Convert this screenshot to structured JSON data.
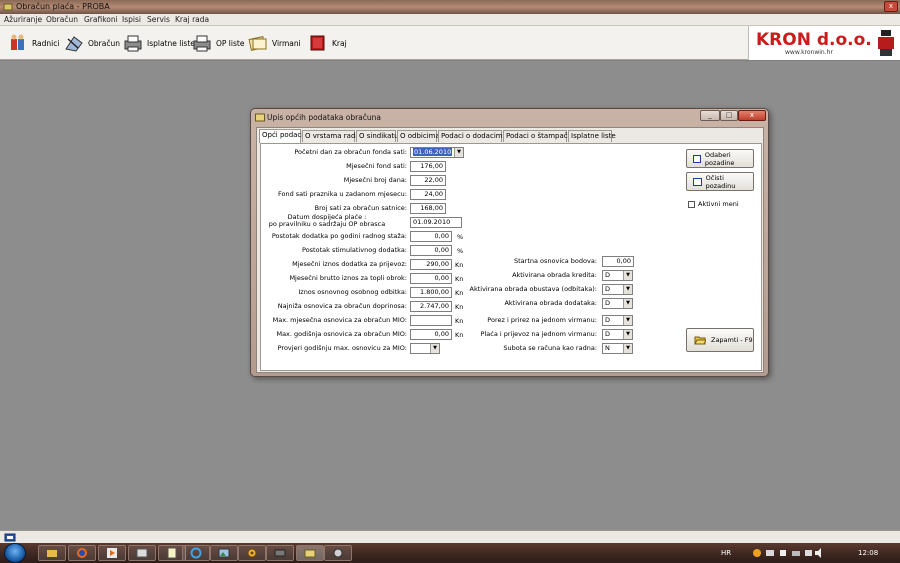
{
  "app": {
    "title": "Obračun plaća - PROBA",
    "close_glyph": "x"
  },
  "menu": [
    "Ažuriranje",
    "Obračun",
    "Grafikoni",
    "Ispisi",
    "Servis",
    "Kraj rada"
  ],
  "toolbar": {
    "buttons": [
      {
        "label": "Radnici",
        "icon": "workers-icon"
      },
      {
        "label": "Obračun",
        "icon": "calculation-icon"
      },
      {
        "label": "Isplatne liste",
        "icon": "payslips-printer-icon"
      },
      {
        "label": "OP liste",
        "icon": "op-lists-printer-icon"
      },
      {
        "label": "Virmani",
        "icon": "transfer-orders-icon"
      },
      {
        "label": "Kraj",
        "icon": "exit-icon"
      }
    ],
    "logo": {
      "name": "KRON d.o.o.",
      "url": "www.kronwin.hr"
    }
  },
  "dialog": {
    "title": "Upis općih podataka obračuna",
    "window_buttons": {
      "minimize": "_",
      "maximize": "□",
      "close": "x"
    },
    "tabs": [
      "Opći podaci",
      "O vrstama rada",
      "O sindikatu",
      "O odbicima",
      "Podaci o dodacima",
      "Podaci o štampaču",
      "Isplatne liste"
    ],
    "active_tab": "Opći podaci",
    "left_fields": [
      {
        "label": "Početni dan za obračun fonda sati:",
        "value": "01.06.2010",
        "unit": "",
        "dropdown": true
      },
      {
        "label": "Mjesečni fond sati:",
        "value": "176,00",
        "unit": ""
      },
      {
        "label": "Mjesečni broj dana:",
        "value": "22,00",
        "unit": ""
      },
      {
        "label": "Fond sati praznika u zadanom mjesecu:",
        "value": "24,00",
        "unit": ""
      },
      {
        "label": "Broj sati za obračun satnice:",
        "value": "168,00",
        "unit": ""
      },
      {
        "label": "Datum dospijeća plaće :\npo pravilniku o sadržaju OP obrasca",
        "value": "01.09.2010",
        "unit": ""
      },
      {
        "label": "Postotak dodatka po godini radnog staža:",
        "value": "0,00",
        "unit": "%"
      },
      {
        "label": "Postotak stimulativnog dodatka:",
        "value": "0,00",
        "unit": "%"
      },
      {
        "label": "Mjesečni iznos dodatka za prijevoz:",
        "value": "290,00",
        "unit": "Kn"
      },
      {
        "label": "Mjesečni brutto iznos za topli obrok:",
        "value": "0,00",
        "unit": "Kn"
      },
      {
        "label": "Iznos osnovnog osobnog odbitka:",
        "value": "1.800,00",
        "unit": "Kn"
      },
      {
        "label": "Najniža osnovica za obračun doprinosa:",
        "value": "2.747,00",
        "unit": "Kn"
      },
      {
        "label": "Max. mjesečna osnovica za obračun MIO:",
        "value": "",
        "unit": "Kn"
      },
      {
        "label": "Max. godišnja osnovica za obračun MIO:",
        "value": "0,00",
        "unit": "Kn"
      },
      {
        "label": "Provjeri godišnju max. osnovicu za MIO:",
        "value": "",
        "unit": "",
        "dropdown": true
      }
    ],
    "right_fields": [
      {
        "label": "Startna osnovica bodova:",
        "value": "0,00"
      },
      {
        "label": "Aktivirana obrada kredita:",
        "value": "D"
      },
      {
        "label": "Aktivirana obrada obustava (odbitaka):",
        "value": "D"
      },
      {
        "label": "Aktivirana obrada dodataka:",
        "value": "D"
      },
      {
        "label": "Porez i prirez na jednom virmanu:",
        "value": "D"
      },
      {
        "label": "Plaća i prijevoz na jednom virmanu:",
        "value": "D"
      },
      {
        "label": "Subota se računa kao radna:",
        "value": "N"
      }
    ],
    "buttons": {
      "choose_background": "Odaberi pozadine",
      "clear_background": "Očisti pozadinu",
      "save": "Zapamti - F9"
    },
    "active_menu_checkbox": {
      "label": "Aktivni meni",
      "checked": false
    }
  },
  "taskbar": {
    "language": "HR",
    "clock": "12:08"
  }
}
